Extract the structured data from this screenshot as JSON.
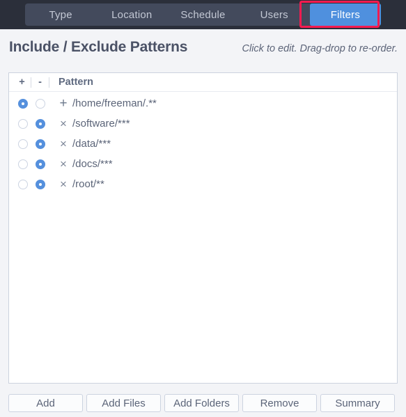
{
  "tabs": {
    "items": [
      {
        "label": "Type",
        "active": false
      },
      {
        "label": "Location",
        "active": false
      },
      {
        "label": "Schedule",
        "active": false
      },
      {
        "label": "Users",
        "active": false
      },
      {
        "label": "Filters",
        "active": true
      }
    ],
    "highlight_color": "#f71b50",
    "active_color": "#4f90de",
    "bar_color": "#434a5c"
  },
  "header": {
    "title": "Include / Exclude Patterns",
    "hint": "Click to edit. Drag-drop to re-order."
  },
  "table": {
    "columns": {
      "include": "+",
      "exclude": "-",
      "pattern": "Pattern"
    },
    "rows": [
      {
        "include": true,
        "exclude": false,
        "mark": "+",
        "pattern": "/home/freeman/.**"
      },
      {
        "include": false,
        "exclude": true,
        "mark": "×",
        "pattern": "/software/***"
      },
      {
        "include": false,
        "exclude": true,
        "mark": "×",
        "pattern": "/data/***"
      },
      {
        "include": false,
        "exclude": true,
        "mark": "×",
        "pattern": "/docs/***"
      },
      {
        "include": false,
        "exclude": true,
        "mark": "×",
        "pattern": "/root/**"
      }
    ]
  },
  "footer": {
    "buttons": [
      {
        "label": "Add"
      },
      {
        "label": "Add Files"
      },
      {
        "label": "Add Folders"
      },
      {
        "label": "Remove"
      },
      {
        "label": "Summary"
      }
    ]
  }
}
